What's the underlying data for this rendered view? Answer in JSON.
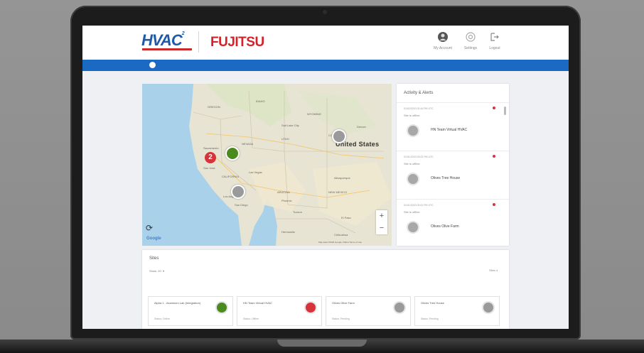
{
  "header": {
    "logo_primary": "HVAC",
    "logo_superscript": "2",
    "logo_secondary": "FUJITSU",
    "buttons": [
      {
        "label": "My Account",
        "icon": "account-icon"
      },
      {
        "label": "Settings",
        "icon": "gear-icon"
      },
      {
        "label": "Logout",
        "icon": "logout-icon"
      }
    ]
  },
  "map": {
    "country_label": "United States",
    "cluster_count": "2",
    "zoom_in": "+",
    "zoom_out": "−",
    "google_label": "Google",
    "attribution": "Map data ©2020 Google, INEGI  Terms of Use",
    "place_labels": [
      "OREGON",
      "IDAHO",
      "WYOMING",
      "NEVADA",
      "UTAH",
      "COLORADO",
      "CALIFORNIA",
      "ARIZONA",
      "NEW MEXICO",
      "Las Vegas",
      "Los Angeles",
      "San Diego",
      "Phoenix",
      "Sacramento",
      "San Jose",
      "Denver",
      "Salt Lake City",
      "Albuquerque",
      "Tucson",
      "El Paso",
      "Chihuahua",
      "Hermosillo"
    ],
    "colors": {
      "online": "#4a8a1e",
      "offline": "#9a9a9a",
      "alert": "#d6333a",
      "water": "#a9d2ea"
    }
  },
  "activity": {
    "title": "Activity & Alerts",
    "items": [
      {
        "time": "01/02/2020 02:44 PM UTC",
        "status": "Site is offline",
        "name": "HN Team Virtual HVAC"
      },
      {
        "time": "01/01/2020 03:02 PM UTC",
        "status": "Site is offline",
        "name": "Olives Tree House"
      },
      {
        "time": "01/01/2020 03:02 PM UTC",
        "status": "Site is offline",
        "name": "Olives Olive Farm"
      }
    ]
  },
  "sites": {
    "title": "Sites",
    "show_label": "Show",
    "show_value": "20",
    "right_label": "Sites 4",
    "cards": [
      {
        "name": "Alpha 1 - Aluminum Lab (Integration)",
        "status": "Status: Online",
        "state": "online"
      },
      {
        "name": "HN Team Virtual HVAC",
        "status": "Status: Offline",
        "state": "alert"
      },
      {
        "name": "Olives Olive Farm",
        "status": "Status: Pending",
        "state": "offline"
      },
      {
        "name": "Olives Tree House",
        "status": "Status: Pending",
        "state": "offline"
      }
    ]
  }
}
